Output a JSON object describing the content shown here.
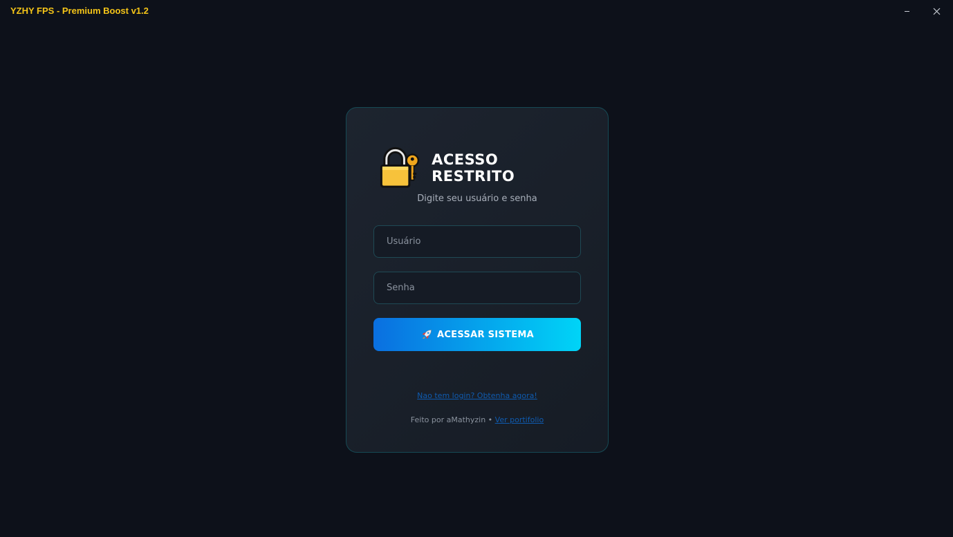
{
  "window": {
    "title": "YZHY FPS - Premium Boost v1.2",
    "minimize_symbol": "–",
    "close_symbol": "✕"
  },
  "login": {
    "icon": "lock-key-icon",
    "title": "ACESSO RESTRITO",
    "subtitle": "Digite seu usuário e senha",
    "username_placeholder": "Usuário",
    "username_value": "",
    "password_placeholder": "Senha",
    "password_value": "",
    "submit_label": "ACESSAR SISTEMA",
    "submit_icon": "rocket-icon",
    "signup_link": "Nao tem login? Obtenha agora!",
    "footer_text": "Feito por aMathyzin • ",
    "portfolio_link": "Ver portifolio"
  },
  "colors": {
    "background": "#0d111a",
    "title_accent": "#f5c518",
    "button_gradient_start": "#0a6fe0",
    "button_gradient_end": "#00d4f7",
    "card_border": "#164a55",
    "link": "#0f5bb0"
  }
}
